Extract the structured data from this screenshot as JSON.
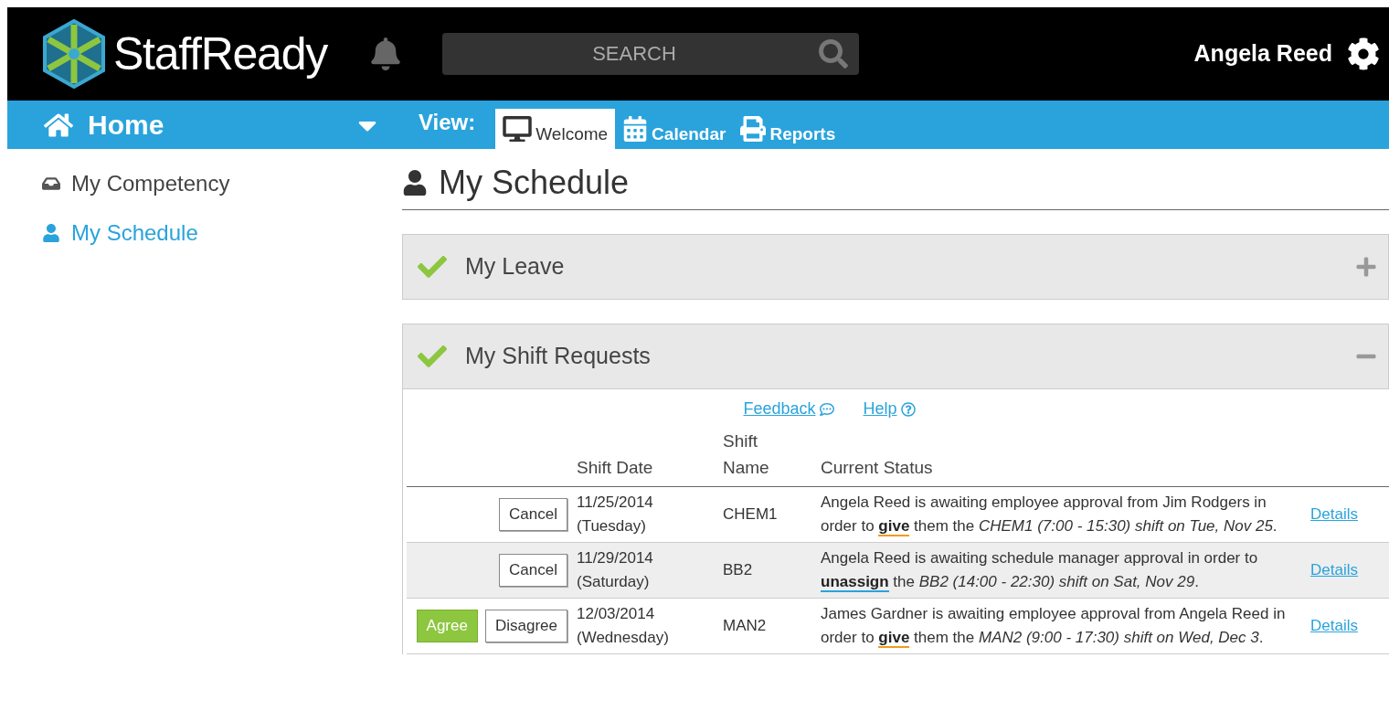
{
  "header": {
    "logo": "StaffReady",
    "search": {
      "placeholder": "SEARCH"
    },
    "user": "Angela Reed"
  },
  "nav": {
    "home": "Home",
    "view_label": "View:",
    "tabs": [
      {
        "label": "Welcome",
        "selected": true
      },
      {
        "label": "Calendar",
        "selected": false
      },
      {
        "label": "Reports",
        "selected": false
      }
    ]
  },
  "sidebar": {
    "items": [
      {
        "label": "My Competency",
        "selected": false
      },
      {
        "label": "My Schedule",
        "selected": true
      }
    ]
  },
  "page_title": "My Schedule",
  "sections": [
    {
      "title": "My Leave",
      "complete": true,
      "expanded": false
    },
    {
      "title": "My Shift Requests",
      "complete": true,
      "expanded": true,
      "links": [
        "Feedback",
        "Help"
      ],
      "table": {
        "columns": [
          "Shift Date",
          "Shift Name",
          "Current Status"
        ],
        "rows": [
          {
            "buttons": [
              {
                "label": "Cancel",
                "kind": "plain"
              }
            ],
            "date": "11/25/2014",
            "day": "(Tuesday)",
            "shift": "CHEM1",
            "status_before": "Angela Reed is awaiting employee approval from Jim Rodgers in order to",
            "action": "give",
            "color": "#f39a1e",
            "status_after": "them the *CHEM1 (7:00 - 15:30) shift on Tue, Nov 25*.",
            "link": "Details"
          },
          {
            "buttons": [
              {
                "label": "Cancel",
                "kind": "plain"
              }
            ],
            "date": "11/29/2014",
            "day": "(Saturday)",
            "shift": "BB2",
            "status_before": "Angela Reed is awaiting schedule manager approval in order to",
            "action": "unassign",
            "color": "#2aa3dc",
            "status_after": "the *BB2 (14:00 - 22:30) shift on Sat, Nov 29*.",
            "link": "Details"
          },
          {
            "buttons": [
              {
                "label": "Agree",
                "kind": "agree"
              },
              {
                "label": "Disagree",
                "kind": "plain"
              }
            ],
            "date": "12/03/2014",
            "day": "(Wednesday)",
            "shift": "MAN2",
            "status_before": "James Gardner is awaiting employee approval from Angela Reed in order to",
            "action": "give",
            "color": "#f39a1e",
            "status_after": "them the *MAN2 (9:00 - 17:30) shift on Wed, Dec 3*.",
            "link": "Details"
          }
        ]
      }
    }
  ]
}
